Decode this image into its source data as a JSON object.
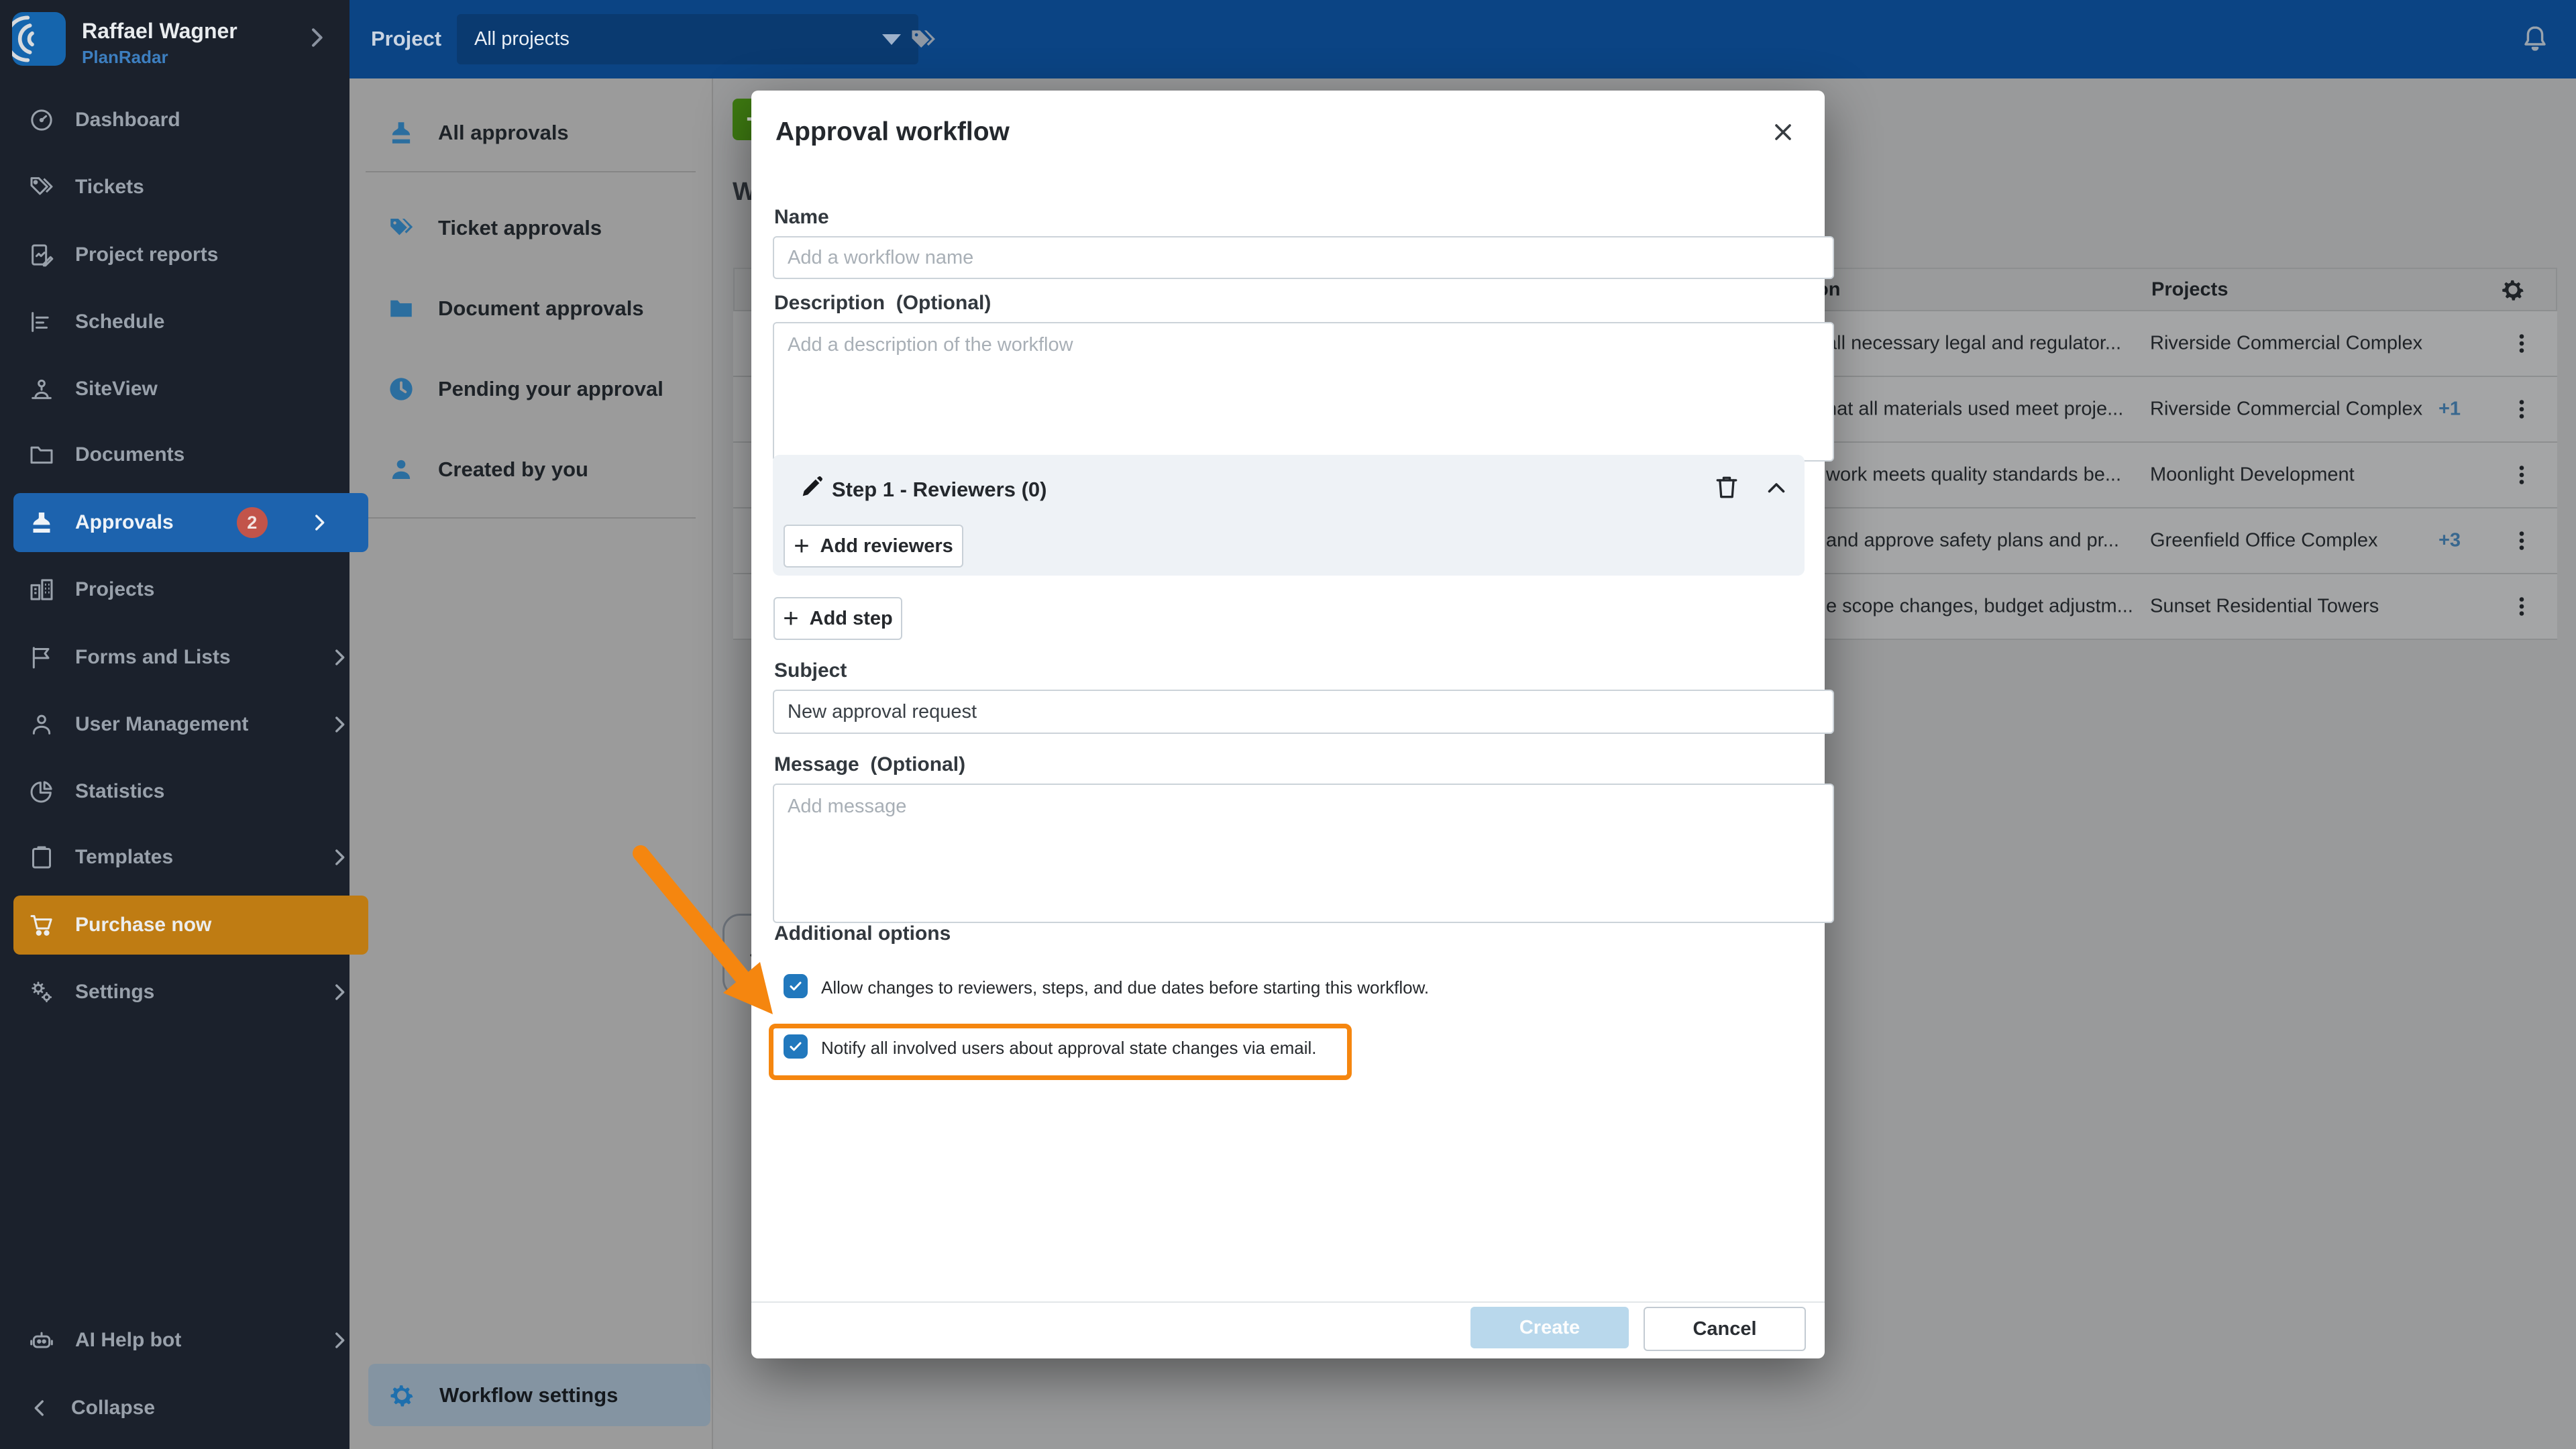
{
  "icons": {
    "plus": "+"
  },
  "topbar": {
    "project_label": "Project",
    "project_dropdown_value": "All projects"
  },
  "sidebar": {
    "user_name": "Raffael Wagner",
    "user_company": "PlanRadar",
    "items": [
      {
        "label": "Dashboard"
      },
      {
        "label": "Tickets"
      },
      {
        "label": "Project reports"
      },
      {
        "label": "Schedule"
      },
      {
        "label": "SiteView"
      },
      {
        "label": "Documents"
      },
      {
        "label": "Approvals",
        "selected": true,
        "badge": "2"
      },
      {
        "label": "Projects"
      },
      {
        "label": "Forms and Lists"
      },
      {
        "label": "User Management"
      },
      {
        "label": "Statistics"
      },
      {
        "label": "Templates"
      },
      {
        "label": "Purchase now",
        "highlight": "orange"
      },
      {
        "label": "Settings"
      }
    ],
    "ai_help_bot": "AI Help bot",
    "collapse": "Collapse"
  },
  "filters": {
    "items": [
      "All approvals",
      "Ticket approvals",
      "Document approvals",
      "Pending your approval",
      "Created by you"
    ],
    "workflow_settings": "Workflow settings"
  },
  "content": {
    "heading_visible_fragment": "W",
    "table": {
      "description_header_fragment": "on",
      "projects_header": "Projects",
      "rows": [
        {
          "description_fragment": "all necessary legal and regulator...",
          "projects": "Riverside Commercial Complex",
          "more_count": ""
        },
        {
          "description_fragment": "hat all materials used meet proje...",
          "projects": "Riverside Commercial Complex",
          "more_count": "+1"
        },
        {
          "description_fragment": "work meets quality standards be...",
          "projects": "Moonlight Development",
          "more_count": ""
        },
        {
          "description_fragment": "and approve safety plans and pr...",
          "projects": "Greenfield Office Complex",
          "more_count": "+3"
        },
        {
          "description_fragment": "e scope changes, budget adjustm...",
          "projects": "Sunset Residential Towers",
          "more_count": ""
        }
      ]
    }
  },
  "modal": {
    "title": "Approval workflow",
    "name_label": "Name",
    "name_placeholder": "Add a workflow name",
    "description_label": "Description",
    "optional_suffix": "(Optional)",
    "description_placeholder": "Add a description of the workflow",
    "step_header": "Step 1 - Reviewers (0)",
    "add_reviewers_label": "Add reviewers",
    "add_step_label": "Add step",
    "subject_label": "Subject",
    "subject_value": "New approval request",
    "message_label": "Message",
    "message_placeholder": "Add message",
    "additional_options_label": "Additional options",
    "options": [
      {
        "label": "Allow changes to reviewers, steps, and due dates before starting this workflow.",
        "checked": true
      },
      {
        "label": "Notify all involved users about approval state changes via email.",
        "checked": true,
        "highlighted": true
      }
    ],
    "create_label": "Create",
    "cancel_label": "Cancel"
  },
  "colors": {
    "topbar_blue": "#0b4484",
    "sidebar_dark": "#1b212c",
    "selected_blue": "#1d63ae",
    "purchase_orange": "#bf7c13",
    "badge_red": "#c2544a",
    "checkbox_blue": "#2178bd",
    "annotation_orange": "#f5860f",
    "create_disabled_blue": "#b9d8ec",
    "new_button_green": "#3e7b11",
    "more_count_blue": "#39688f"
  }
}
